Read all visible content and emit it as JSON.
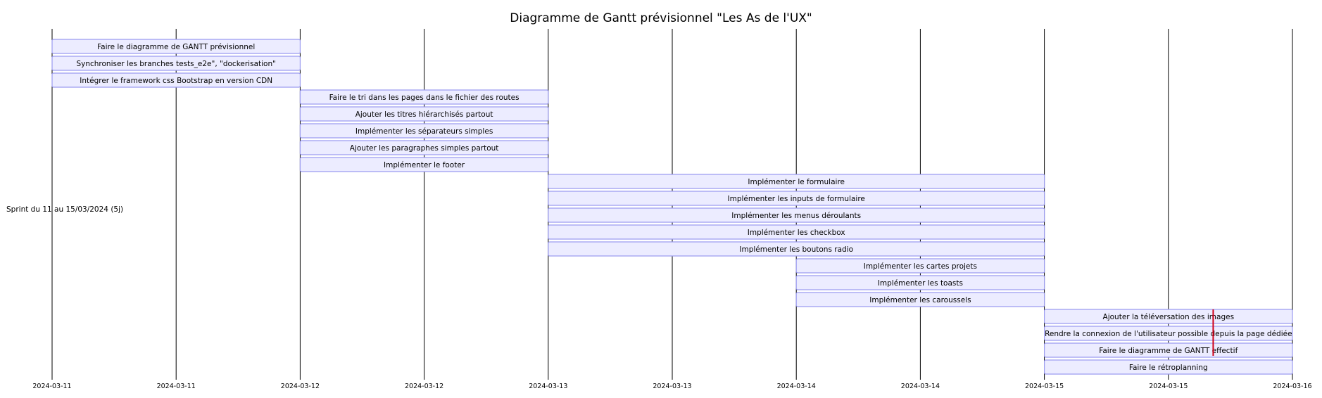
{
  "chart_data": {
    "type": "gantt",
    "title": "Diagramme de Gantt prévisionnel \"Les As de l'UX\"",
    "section": "Sprint du 11 au 15/03/2024 (5j)",
    "x_range": [
      "2024-03-11T00:00",
      "2024-03-16T00:00"
    ],
    "x_ticks": [
      {
        "t": "2024-03-11T00:00",
        "label": "2024-03-11"
      },
      {
        "t": "2024-03-11T12:00",
        "label": "2024-03-11"
      },
      {
        "t": "2024-03-12T00:00",
        "label": "2024-03-12"
      },
      {
        "t": "2024-03-12T12:00",
        "label": "2024-03-12"
      },
      {
        "t": "2024-03-13T00:00",
        "label": "2024-03-13"
      },
      {
        "t": "2024-03-13T12:00",
        "label": "2024-03-13"
      },
      {
        "t": "2024-03-14T00:00",
        "label": "2024-03-14"
      },
      {
        "t": "2024-03-14T12:00",
        "label": "2024-03-14"
      },
      {
        "t": "2024-03-15T00:00",
        "label": "2024-03-15"
      },
      {
        "t": "2024-03-15T12:00",
        "label": "2024-03-15"
      },
      {
        "t": "2024-03-16T00:00",
        "label": "2024-03-16"
      }
    ],
    "tasks": [
      {
        "name": "Faire le diagramme de GANTT prévisionnel",
        "start": "2024-03-11",
        "end": "2024-03-12"
      },
      {
        "name": "Synchroniser les branches tests_e2e\", \"dockerisation\"",
        "start": "2024-03-11",
        "end": "2024-03-12"
      },
      {
        "name": "Intégrer le framework css Bootstrap en version CDN",
        "start": "2024-03-11",
        "end": "2024-03-12"
      },
      {
        "name": "Faire le tri dans les pages dans le fichier des routes",
        "start": "2024-03-12",
        "end": "2024-03-13"
      },
      {
        "name": "Ajouter les titres hiérarchisés partout",
        "start": "2024-03-12",
        "end": "2024-03-13"
      },
      {
        "name": "Implémenter les séparateurs simples",
        "start": "2024-03-12",
        "end": "2024-03-13"
      },
      {
        "name": "Ajouter les paragraphes simples partout",
        "start": "2024-03-12",
        "end": "2024-03-13"
      },
      {
        "name": "Implémenter le footer",
        "start": "2024-03-12",
        "end": "2024-03-13"
      },
      {
        "name": "Implémenter le formulaire",
        "start": "2024-03-13",
        "end": "2024-03-15"
      },
      {
        "name": "Implémenter les inputs de formulaire",
        "start": "2024-03-13",
        "end": "2024-03-15"
      },
      {
        "name": "Implémenter les menus déroulants",
        "start": "2024-03-13",
        "end": "2024-03-15"
      },
      {
        "name": "Implémenter les checkbox",
        "start": "2024-03-13",
        "end": "2024-03-15"
      },
      {
        "name": "Implémenter les boutons radio",
        "start": "2024-03-13",
        "end": "2024-03-15"
      },
      {
        "name": "Implémenter les cartes projets",
        "start": "2024-03-14",
        "end": "2024-03-15"
      },
      {
        "name": "Implémenter les toasts",
        "start": "2024-03-14",
        "end": "2024-03-15"
      },
      {
        "name": "Implémenter les caroussels",
        "start": "2024-03-14",
        "end": "2024-03-15"
      },
      {
        "name": "Ajouter la téléversation des images",
        "start": "2024-03-15",
        "end": "2024-03-16"
      },
      {
        "name": "Rendre la connexion de l'utilisateur possible depuis la page dédiée",
        "start": "2024-03-15",
        "end": "2024-03-16"
      },
      {
        "name": "Faire le diagramme de GANTT effectif",
        "start": "2024-03-15",
        "end": "2024-03-16"
      },
      {
        "name": "Faire le rétroplanning",
        "start": "2024-03-15",
        "end": "2024-03-16"
      }
    ],
    "today_marker": "2024-03-15T16:20",
    "colors": {
      "bar_fill": "#ececff",
      "bar_stroke": "#9b9bf0",
      "grid": "#000000",
      "today": "#d0021b"
    }
  }
}
